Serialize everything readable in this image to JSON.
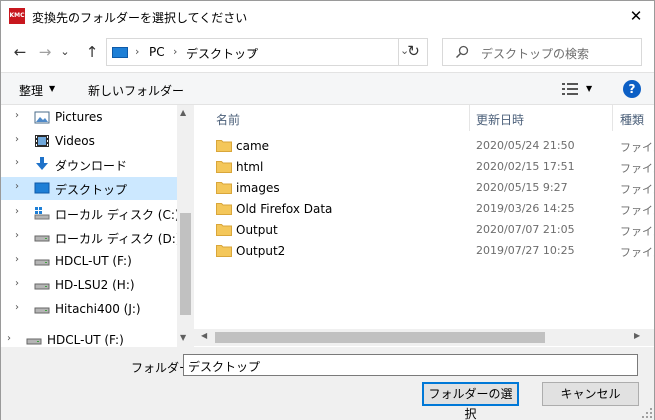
{
  "titlebar": {
    "app_icon_text": "KMC",
    "title": "変換先のフォルダーを選択してください",
    "close_glyph": "✕"
  },
  "nav": {
    "back_glyph": "←",
    "forward_glyph": "→",
    "recent_glyph": "⌄",
    "up_glyph": "↑",
    "breadcrumbs": [
      "PC",
      "デスクトップ"
    ],
    "crumb_separator": "›",
    "address_dropdown_glyph": "⌄",
    "refresh_glyph": "↻",
    "search_placeholder": "デスクトップの検索"
  },
  "toolbar": {
    "organize_label": "整理",
    "caret": "▼",
    "new_folder_label": "新しいフォルダー",
    "help_label": "?"
  },
  "tree": {
    "chevron": "›",
    "items": [
      {
        "label": "Pictures",
        "icon": "pictures-icon",
        "selected": false
      },
      {
        "label": "Videos",
        "icon": "videos-icon",
        "selected": false
      },
      {
        "label": "ダウンロード",
        "icon": "download-icon",
        "selected": false
      },
      {
        "label": "デスクトップ",
        "icon": "desktop-icon",
        "selected": true
      },
      {
        "label": "ローカル ディスク (C:)",
        "icon": "system-drive-icon",
        "selected": false
      },
      {
        "label": "ローカル ディスク (D:)",
        "icon": "drive-icon",
        "selected": false
      },
      {
        "label": "HDCL-UT (F:)",
        "icon": "drive-icon",
        "selected": false
      },
      {
        "label": "HD-LSU2 (H:)",
        "icon": "drive-icon",
        "selected": false
      },
      {
        "label": "Hitachi400 (J:)",
        "icon": "drive-icon",
        "selected": false
      },
      {
        "label": "HDCL-UT (F:)",
        "icon": "drive-icon",
        "selected": false
      }
    ]
  },
  "files": {
    "columns": {
      "name": "名前",
      "date": "更新日時",
      "type": "種類"
    },
    "sort_glyph": "^",
    "rows": [
      {
        "name": "came",
        "date": "2020/05/24 21:50",
        "type": "ファイル"
      },
      {
        "name": "html",
        "date": "2020/02/15 17:51",
        "type": "ファイル"
      },
      {
        "name": "images",
        "date": "2020/05/15 9:27",
        "type": "ファイル"
      },
      {
        "name": "Old Firefox Data",
        "date": "2019/03/26 14:25",
        "type": "ファイル"
      },
      {
        "name": "Output",
        "date": "2020/07/07 21:05",
        "type": "ファイル"
      },
      {
        "name": "Output2",
        "date": "2019/07/27 10:25",
        "type": "ファイル"
      }
    ]
  },
  "scroll": {
    "up": "▲",
    "down": "▼",
    "left": "◀",
    "right": "▶"
  },
  "bottom": {
    "folder_label": "フォルダー:",
    "folder_value": "デスクトップ",
    "select_button": "フォルダーの選択",
    "cancel_button": "キャンセル"
  },
  "colors": {
    "accent": "#0078d7",
    "selection": "#cce8ff",
    "folder": "#f4c75a"
  }
}
